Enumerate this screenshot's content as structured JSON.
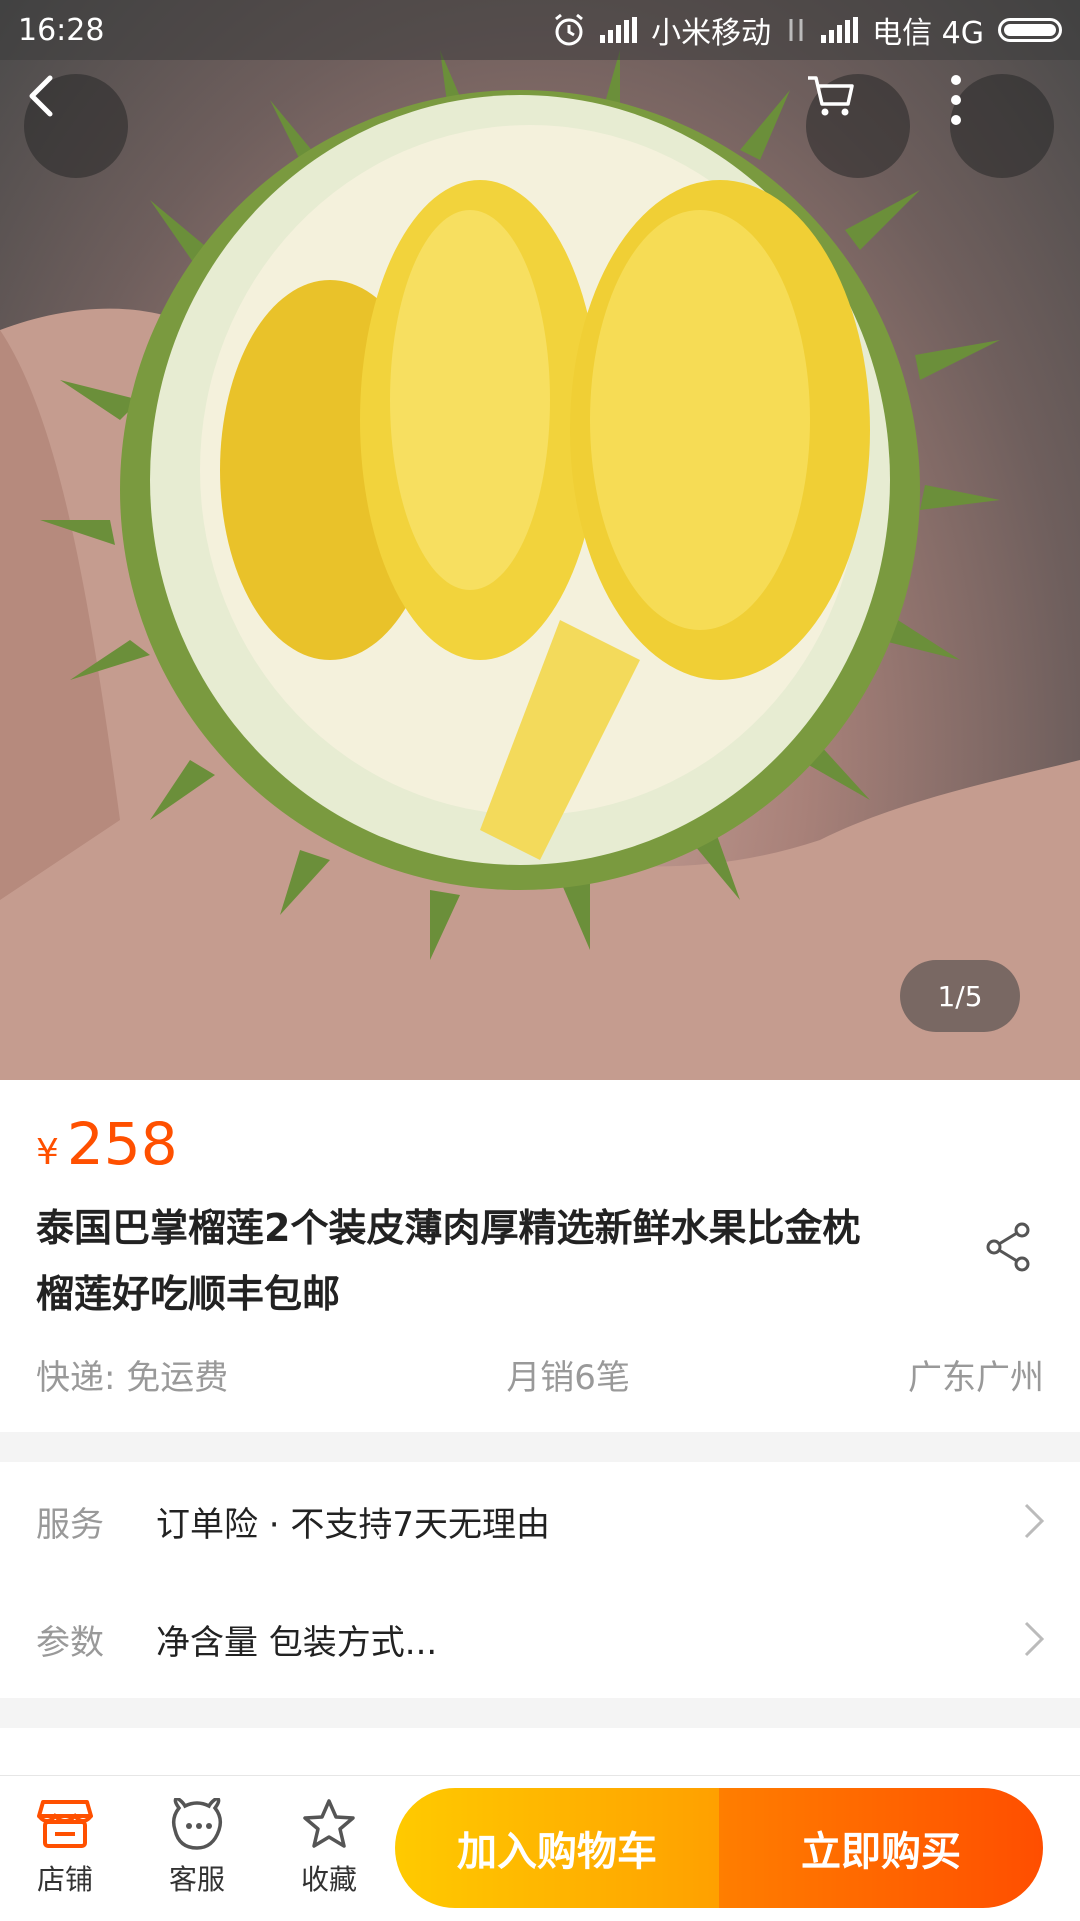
{
  "status_bar": {
    "time": "16:28",
    "carrier1": "小米移动",
    "carrier2": "电信 4G"
  },
  "hero": {
    "image_counter": "1/5",
    "icons": [
      "back-icon",
      "cart-icon",
      "more-icon"
    ]
  },
  "product": {
    "currency": "¥",
    "price": "258",
    "title": "泰国巴掌榴莲2个装皮薄肉厚精选新鲜水果比金枕榴莲好吃顺丰包邮",
    "shipping": "快递: 免运费",
    "monthly_sales": "月销6笔",
    "location": "广东广州"
  },
  "services": [
    {
      "label": "服务",
      "value": "订单险 · 不支持7天无理由"
    },
    {
      "label": "参数",
      "value": "净含量 包装方式..."
    }
  ],
  "bottom_bar": {
    "tabs": [
      {
        "label": "店铺",
        "icon": "shop-icon"
      },
      {
        "label": "客服",
        "icon": "customer-service-icon"
      },
      {
        "label": "收藏",
        "icon": "star-icon"
      }
    ],
    "add_to_cart": "加入购物车",
    "buy_now": "立即购买"
  },
  "colors": {
    "price": "#ff5000",
    "cart_button": "#ffb400",
    "buy_button": "#ff6200",
    "shop_icon": "#ff5000"
  }
}
